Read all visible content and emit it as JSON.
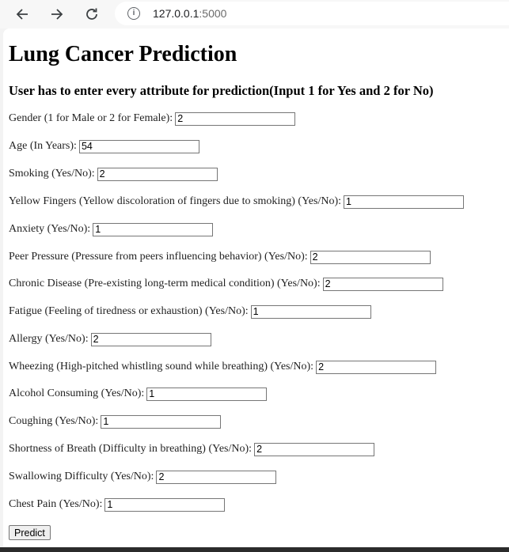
{
  "browser": {
    "url_host": "127.0.0.1",
    "url_port": ":5000",
    "info_glyph": "i"
  },
  "page": {
    "title": "Lung Cancer Prediction",
    "subtitle": "User has to enter every attribute for prediction(Input 1 for Yes and 2 for No)",
    "predict_label": "Predict"
  },
  "form": {
    "fields": [
      {
        "name": "gender",
        "label": "Gender (1 for Male or 2 for Female):",
        "value": "2"
      },
      {
        "name": "age",
        "label": "Age (In Years):",
        "value": "54"
      },
      {
        "name": "smoking",
        "label": "Smoking (Yes/No):",
        "value": "2"
      },
      {
        "name": "yellow-fingers",
        "label": "Yellow Fingers (Yellow discoloration of fingers due to smoking) (Yes/No):",
        "value": "1"
      },
      {
        "name": "anxiety",
        "label": "Anxiety (Yes/No):",
        "value": "1"
      },
      {
        "name": "peer-pressure",
        "label": "Peer Pressure (Pressure from peers influencing behavior) (Yes/No):",
        "value": "2"
      },
      {
        "name": "chronic-disease",
        "label": "Chronic Disease (Pre-existing long-term medical condition) (Yes/No):",
        "value": "2"
      },
      {
        "name": "fatigue",
        "label": "Fatigue (Feeling of tiredness or exhaustion) (Yes/No):",
        "value": "1"
      },
      {
        "name": "allergy",
        "label": "Allergy (Yes/No):",
        "value": "2"
      },
      {
        "name": "wheezing",
        "label": "Wheezing (High-pitched whistling sound while breathing) (Yes/No):",
        "value": "2"
      },
      {
        "name": "alcohol-consuming",
        "label": "Alcohol Consuming (Yes/No):",
        "value": "1"
      },
      {
        "name": "coughing",
        "label": "Coughing (Yes/No):",
        "value": "1"
      },
      {
        "name": "shortness-of-breath",
        "label": "Shortness of Breath (Difficulty in breathing) (Yes/No):",
        "value": "2"
      },
      {
        "name": "swallowing-difficulty",
        "label": "Swallowing Difficulty (Yes/No):",
        "value": "2"
      },
      {
        "name": "chest-pain",
        "label": "Chest Pain (Yes/No):",
        "value": "1"
      }
    ]
  }
}
